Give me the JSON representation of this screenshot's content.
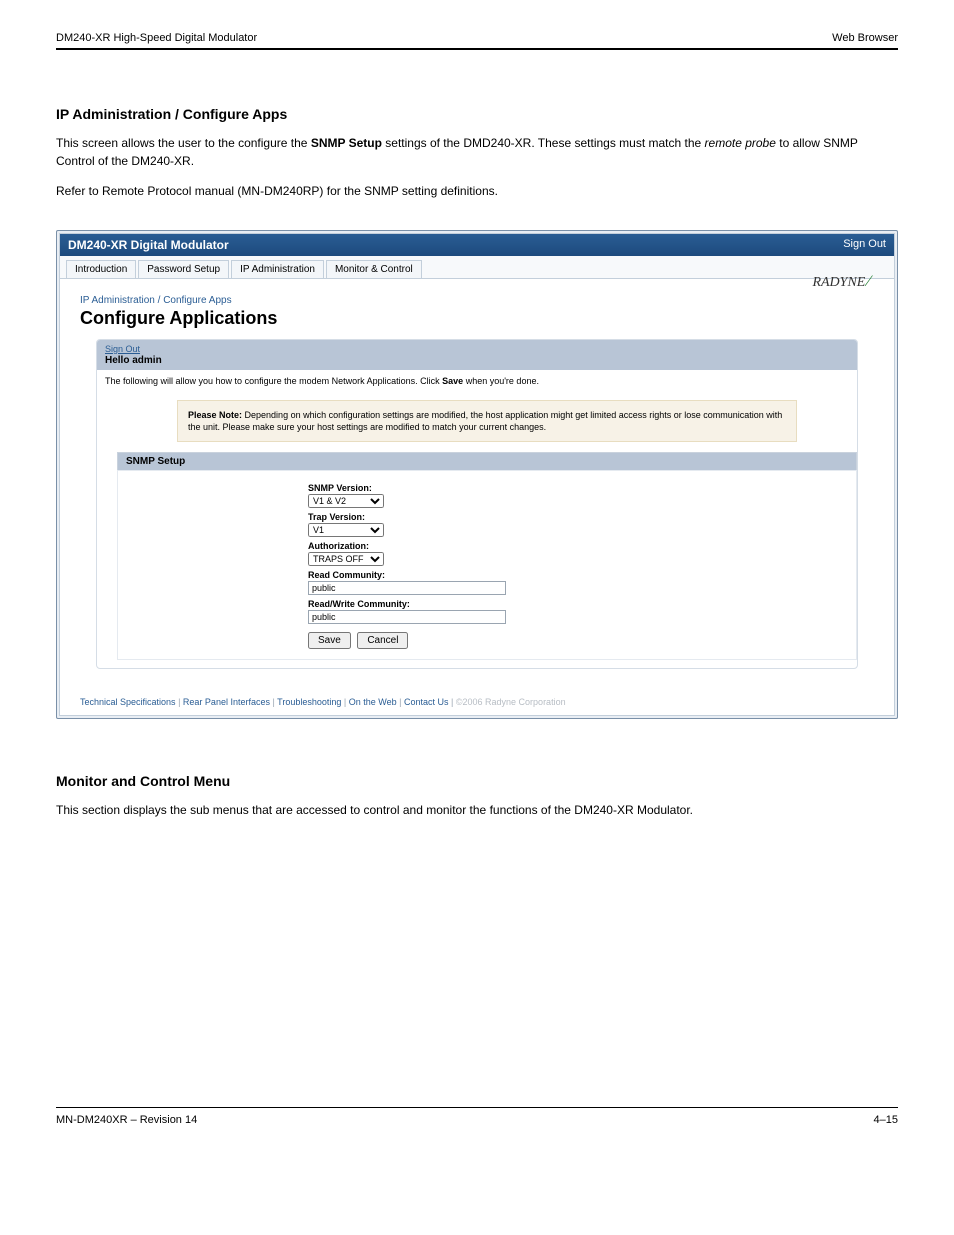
{
  "doc": {
    "header_left": "DM240-XR High-Speed Digital Modulator",
    "header_right": "Web Browser",
    "rev_line": "MN-DM240XR – Revision 14",
    "page_number": "4–15",
    "sec_ip": "IP Administration / Configure Apps",
    "intro1a": "This screen allows the user to the configure the ",
    "snmp": "SNMP Setup",
    "intro1b": " settings of the DMD240-XR.  These settings must match the ",
    "probe": "remote probe",
    "intro1c": " to allow SNMP Control of the DM240-XR.",
    "intro_refer": "Refer to Remote Protocol manual (MN-DM240RP) for the SNMP setting definitions.",
    "sec_mon": "Monitor and Control Menu",
    "mon_text": "This section displays the sub menus that are accessed to control and monitor the functions of the DM240-XR Modulator."
  },
  "ui": {
    "window_title": "DM240-XR Digital Modulator",
    "signout": "Sign Out",
    "tabs": [
      "Introduction",
      "Password Setup",
      "IP Administration",
      "Monitor & Control"
    ],
    "breadcrumb": "IP Administration / Configure Apps",
    "page_title": "Configure Applications",
    "brand": "RADYNE",
    "hello": "Hello admin",
    "panel_text_a": "The following will allow you how to configure the modem Network Applications. Click ",
    "panel_text_save": "Save",
    "panel_text_b": " when you're done.",
    "note_label": "Please Note:",
    "note_text": " Depending on which configuration settings are modified, the host application might get limited access rights or lose communication with the unit. Please make sure your host settings are modified to match your current changes.",
    "snmp_header": "SNMP Setup",
    "fields": {
      "snmp_version_label": "SNMP Version:",
      "snmp_version_value": "V1 & V2",
      "trap_version_label": "Trap Version:",
      "trap_version_value": "V1",
      "auth_label": "Authorization:",
      "auth_value": "TRAPS OFF",
      "read_comm_label": "Read Community:",
      "read_comm_value": "public",
      "rw_comm_label": "Read/Write Community:",
      "rw_comm_value": "public"
    },
    "buttons": {
      "save": "Save",
      "cancel": "Cancel"
    },
    "footer": {
      "links": [
        "Technical Specifications",
        "Rear Panel Interfaces",
        "Troubleshooting",
        "On the Web",
        "Contact Us"
      ],
      "copyright": "©2006 Radyne Corporation"
    }
  }
}
